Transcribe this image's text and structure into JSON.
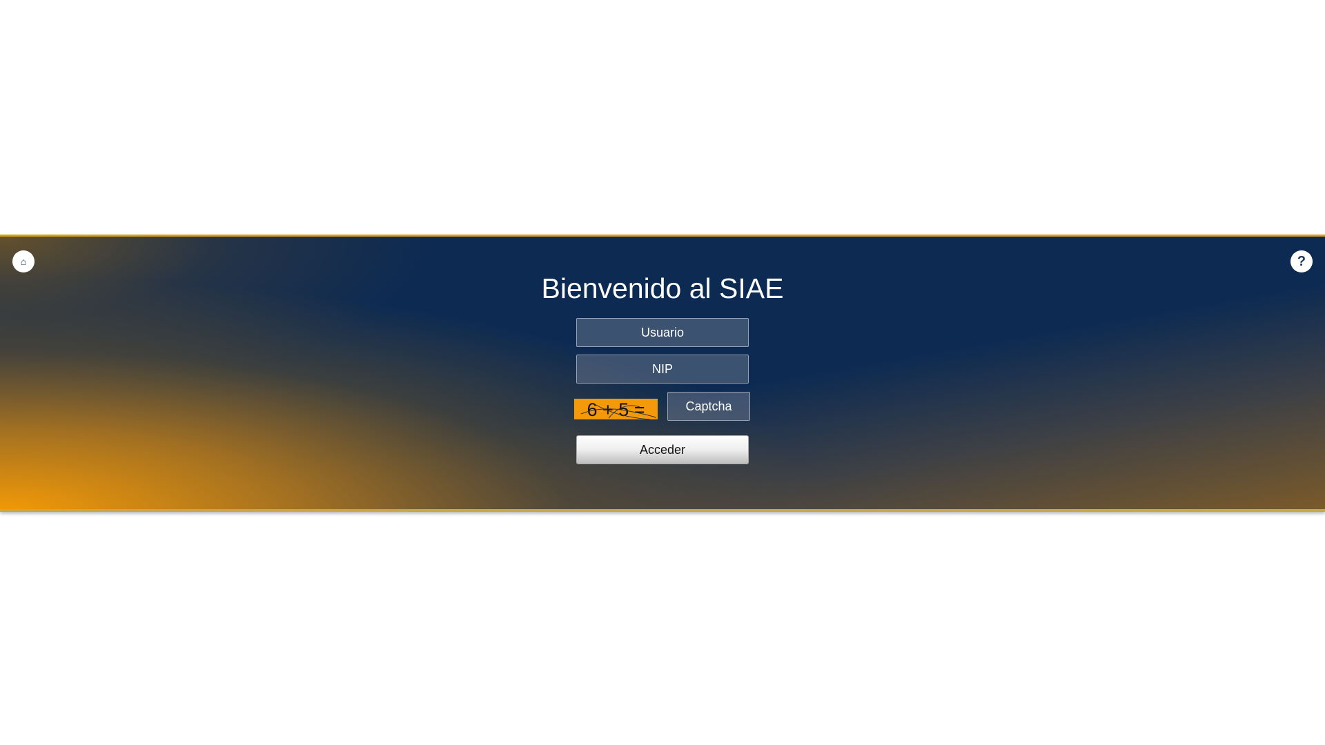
{
  "header": {
    "left_icon": "home-icon",
    "help_icon_glyph": "?"
  },
  "login": {
    "title": "Bienvenido al SIAE",
    "user_placeholder": "Usuario",
    "nip_placeholder": "NIP",
    "captcha_text": "6 + 5 =",
    "captcha_placeholder": "Captcha",
    "submit_label": "Acceder"
  },
  "colors": {
    "navy": "#0c2a52",
    "orange": "#f49a0a",
    "border_gold": "#d9a21a"
  }
}
